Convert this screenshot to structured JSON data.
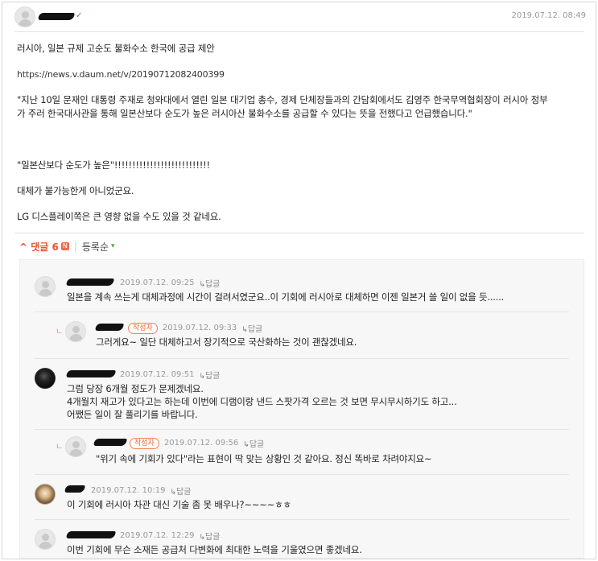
{
  "post": {
    "author_badge": "✓",
    "date": "2019.07.12. 08:49",
    "lines": [
      "러시아, 일본 규제 고순도 불화수소 한국에 공급 제안",
      "https://news.v.daum.net/v/20190712082400399",
      "\"지난 10일 문재인 대통령 주재로 청와대에서 열린 일본 대기업 총수, 경제 단체장들과의 간담회에서도 김영주 한국무역협회장이 러시아 정부",
      "가 주러 한국대사관을 통해 일본산보다 순도가 높은 러시아산 불화수소를 공급할 수 있다는 뜻을 전했다고 언급했습니다.\"",
      "\"일본산보다 순도가 높은\"!!!!!!!!!!!!!!!!!!!!!!!!!!!",
      "대체가 불가능한게 아니었군요.",
      "LG 디스플레이쪽은 큰 영향 없을 수도 있을 것 같네요."
    ]
  },
  "comments_bar": {
    "toggle_label": "^ 댓글 6",
    "badge": "N",
    "sort_label": "등록순",
    "sort_arrow": "▾"
  },
  "reply_label": "답글",
  "reply_arrow": "↳",
  "author_tag": "작성자",
  "reply_mark": "ㄴ",
  "comments": [
    {
      "date": "2019.07.12. 09:25",
      "lines": [
        "일본을 계속 쓰는게 대체과정에 시간이 걸려서였군요..이 기회에 러시아로 대체하면 이젠 일본거 쓸 일이 없을 듯......"
      ]
    },
    {
      "date": "2019.07.12. 09:33",
      "lines": [
        "그러게요~ 일단 대체하고서 장기적으로 국산화하는 것이 괜찮겠네요."
      ]
    },
    {
      "date": "2019.07.12. 09:51",
      "lines": [
        "그럼 당장 6개월 정도가 문제겠네요.",
        "4개월치 재고가 있다고는 하는데 이번에 디램이랑 낸드 스팟가격 오르는 것 보면 무시무시하기도 하고...",
        "어쨌든 일이 잘 풀리기를 바랍니다."
      ]
    },
    {
      "date": "2019.07.12. 09:56",
      "lines": [
        "\"위기 속에 기회가 있다\"라는 표현이 딱 맞는 상황인 것 같아요. 정신 똑바로 차려야지요~"
      ]
    },
    {
      "date": "2019.07.12. 10:19",
      "lines": [
        "이 기회에 러시아 차관 대신 기술 좀 못 배우나?~~~~ㅎㅎ"
      ]
    },
    {
      "date": "2019.07.12. 12:29",
      "lines": [
        "이번 기회에 무슨 소재든 공급처 다변화에 최대한 노력을 기울였으면 좋겠네요."
      ]
    }
  ]
}
